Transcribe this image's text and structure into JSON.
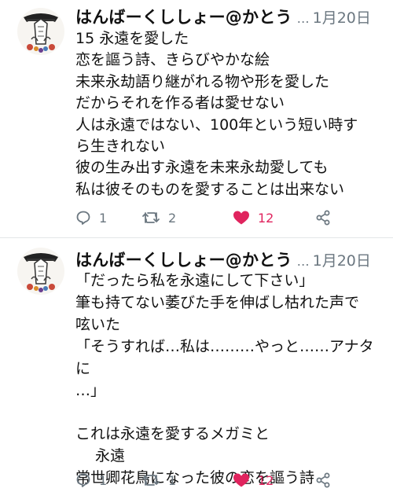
{
  "tweets": [
    {
      "author": "はんばーくししょー@かとう",
      "ellipsis": "…",
      "date": "1月20日",
      "text": "15 永遠を愛した\n恋を謳う詩、きらびやかな絵\n未来永劫語り継がれる物や形を愛した\nだからそれを作る者は愛せない\n人は永遠ではない、100年という短い時す\nら生きれない\n彼の生み出す永遠を未来永劫愛しても\n私は彼そのものを愛することは出来ない",
      "replies": "1",
      "retweets": "2",
      "likes": "12",
      "liked": true
    },
    {
      "author": "はんばーくししょー@かとう",
      "ellipsis": "…",
      "date": "1月20日",
      "text": "「だったら私を永遠にして下さい」\n筆も持てない萎びた手を伸ばし枯れた声で\n呟いた\n「そうすれば…私は………やっと……アナタに\n…」\n\nこれは永遠を愛するメガミと\n　 永遠\n常世卿花鳥になった彼の恋を謳う詩",
      "replies": "1",
      "retweets": "1",
      "likes": "12",
      "liked": true
    }
  ],
  "colors": {
    "text": "#111111",
    "muted": "#6b7780",
    "like": "#e0245e",
    "divider": "#e3e6e8"
  },
  "icons": {
    "reply": "reply-icon",
    "retweet": "retweet-icon",
    "like": "heart-icon",
    "share": "share-icon",
    "menu": "chevron-down-icon"
  }
}
